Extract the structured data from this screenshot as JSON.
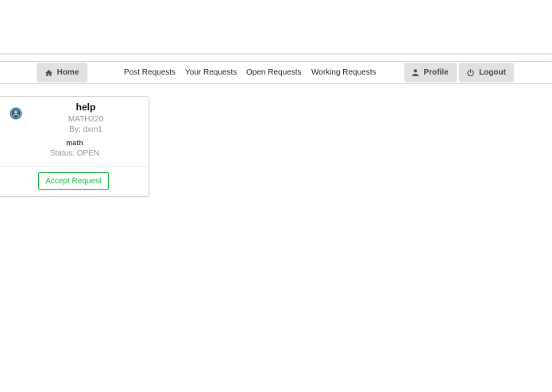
{
  "nav": {
    "home": {
      "label": "Home",
      "icon": "home-icon"
    },
    "links": [
      {
        "label": "Post Requests"
      },
      {
        "label": "Your Requests"
      },
      {
        "label": "Open Requests"
      },
      {
        "label": "Working Requests"
      }
    ],
    "profile": {
      "label": "Profile",
      "icon": "user-icon"
    },
    "logout": {
      "label": "Logout",
      "icon": "power-icon"
    }
  },
  "request_card": {
    "avatar_icon": "avatar-icon",
    "title": "help",
    "course": "MATH220",
    "by": "By: dxm1",
    "subject": "math",
    "status": "Status: OPEN",
    "accept_label": "Accept Request",
    "accent_color": "#21ba45"
  }
}
